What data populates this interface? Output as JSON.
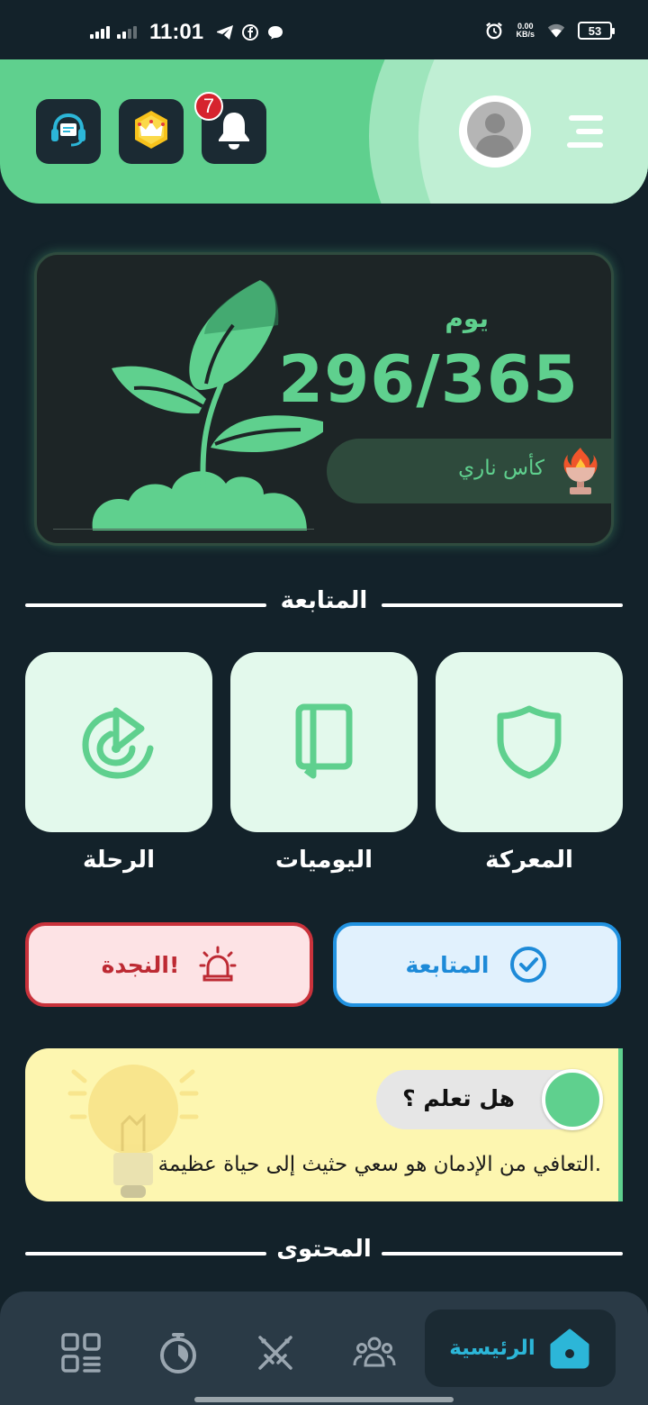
{
  "status_bar": {
    "time": "11:01",
    "net_speed_value": "0.00",
    "net_speed_unit": "KB/s",
    "battery": "53"
  },
  "header": {
    "notification_count": "7",
    "icons": [
      "support-headset-icon",
      "premium-crown-icon",
      "bell-icon",
      "avatar-icon",
      "menu-icon"
    ],
    "colors": {
      "header_green": "#5fd08e",
      "header_light": "#c0efd4"
    }
  },
  "progress": {
    "day_label": "يوم",
    "day_count": "296/365",
    "days_done": 296,
    "days_total": 365,
    "trophy_label": "كأس ناري",
    "trophy_icon": "fire-cup-icon"
  },
  "sections": {
    "tracking_title": "المتابعة",
    "content_title": "المحتوى"
  },
  "tiles": [
    {
      "label": "المعركة",
      "icon": "shield-icon"
    },
    {
      "label": "اليوميات",
      "icon": "notebook-icon"
    },
    {
      "label": "الرحلة",
      "icon": "target-play-icon"
    }
  ],
  "actions": {
    "followup_label": "المتابعة",
    "rescue_label": "النجدة!"
  },
  "tip": {
    "title": "هل تعلم ؟",
    "text": "التعافي من الإدمان هو سعي حثيث إلى حياة عظيمة."
  },
  "bottom_nav": {
    "home_label": "الرئيسية",
    "items": [
      "home-icon",
      "community-icon",
      "battle-swords-icon",
      "timer-icon",
      "dashboard-icon"
    ],
    "accent": "#2cb6d8"
  }
}
